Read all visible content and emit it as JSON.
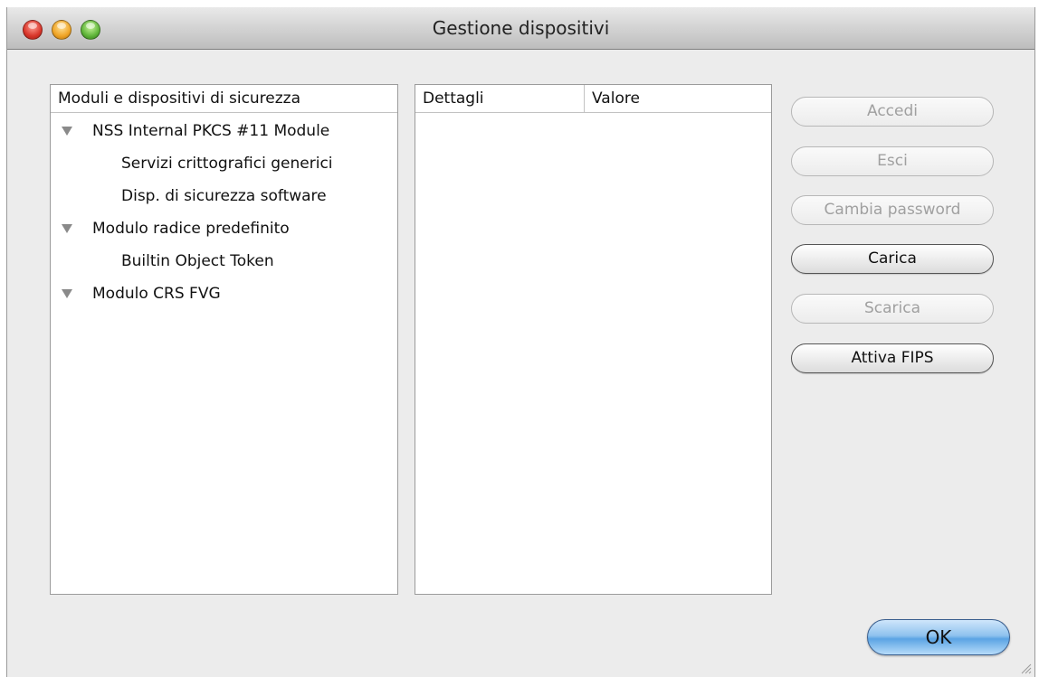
{
  "window": {
    "title": "Gestione dispositivi"
  },
  "tree": {
    "header": "Moduli e dispositivi di sicurezza",
    "items": [
      {
        "label": "NSS Internal PKCS #11 Module",
        "expanded": true,
        "children": [
          "Servizi crittografici generici",
          "Disp. di sicurezza software"
        ]
      },
      {
        "label": "Modulo radice predefinito",
        "expanded": true,
        "children": [
          "Builtin Object Token"
        ]
      },
      {
        "label": "Modulo CRS FVG",
        "expanded": true,
        "children": []
      }
    ]
  },
  "details": {
    "headers": [
      "Dettagli",
      "Valore"
    ]
  },
  "buttons": {
    "accedi": "Accedi",
    "esci": "Esci",
    "cambia_password": "Cambia password",
    "carica": "Carica",
    "scarica": "Scarica",
    "attiva_fips": "Attiva FIPS",
    "ok": "OK"
  },
  "icons": {
    "disclosure": "disclosure-triangle-down-icon",
    "close": "close-window-icon",
    "minimize": "minimize-window-icon",
    "zoom": "zoom-window-icon",
    "resize": "resize-grip-icon"
  },
  "colors": {
    "window_bg": "#ececec",
    "default_button": "#5ba4e4",
    "disabled_text": "#a0a0a0"
  }
}
